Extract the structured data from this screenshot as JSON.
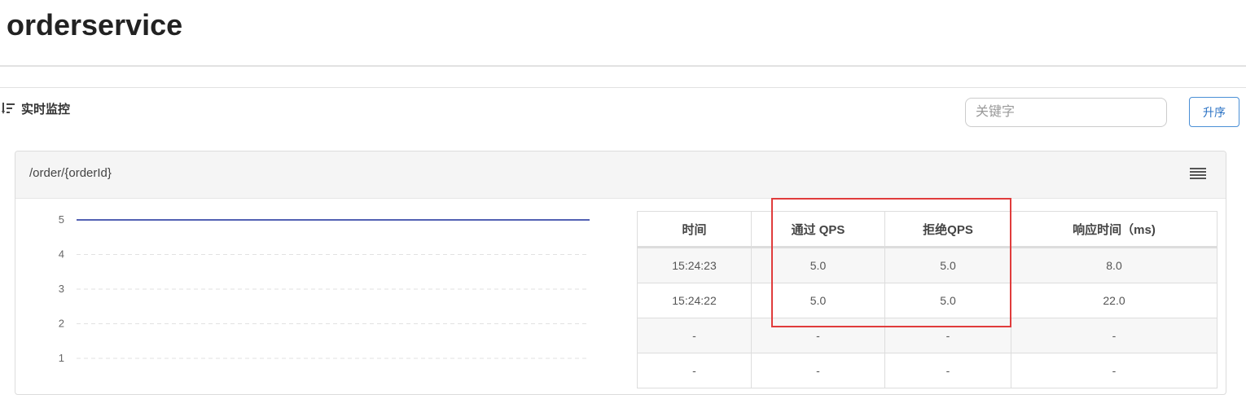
{
  "app": {
    "title": "orderservice"
  },
  "section": {
    "title": "实时监控"
  },
  "search": {
    "placeholder": "关键字",
    "value": ""
  },
  "sort_button": {
    "label": "升序"
  },
  "resource": {
    "name": "/order/{orderId}",
    "table": {
      "headers": [
        "时间",
        "通过 QPS",
        "拒绝QPS",
        "响应时间（ms)"
      ],
      "rows": [
        [
          "15:24:23",
          "5.0",
          "5.0",
          "8.0"
        ],
        [
          "15:24:22",
          "5.0",
          "5.0",
          "22.0"
        ],
        [
          "-",
          "-",
          "-",
          "-"
        ],
        [
          "-",
          "-",
          "-",
          "-"
        ]
      ]
    }
  },
  "chart_data": {
    "type": "line",
    "ylim": [
      0,
      5
    ],
    "yticks": [
      5,
      4,
      3,
      2,
      1
    ],
    "series": [
      {
        "values": [
          5,
          5
        ],
        "color": "#1a2f9c"
      }
    ]
  },
  "colors": {
    "accent": "#2a72c4",
    "highlight": "#e03c3c",
    "line": "#1a2f9c"
  }
}
